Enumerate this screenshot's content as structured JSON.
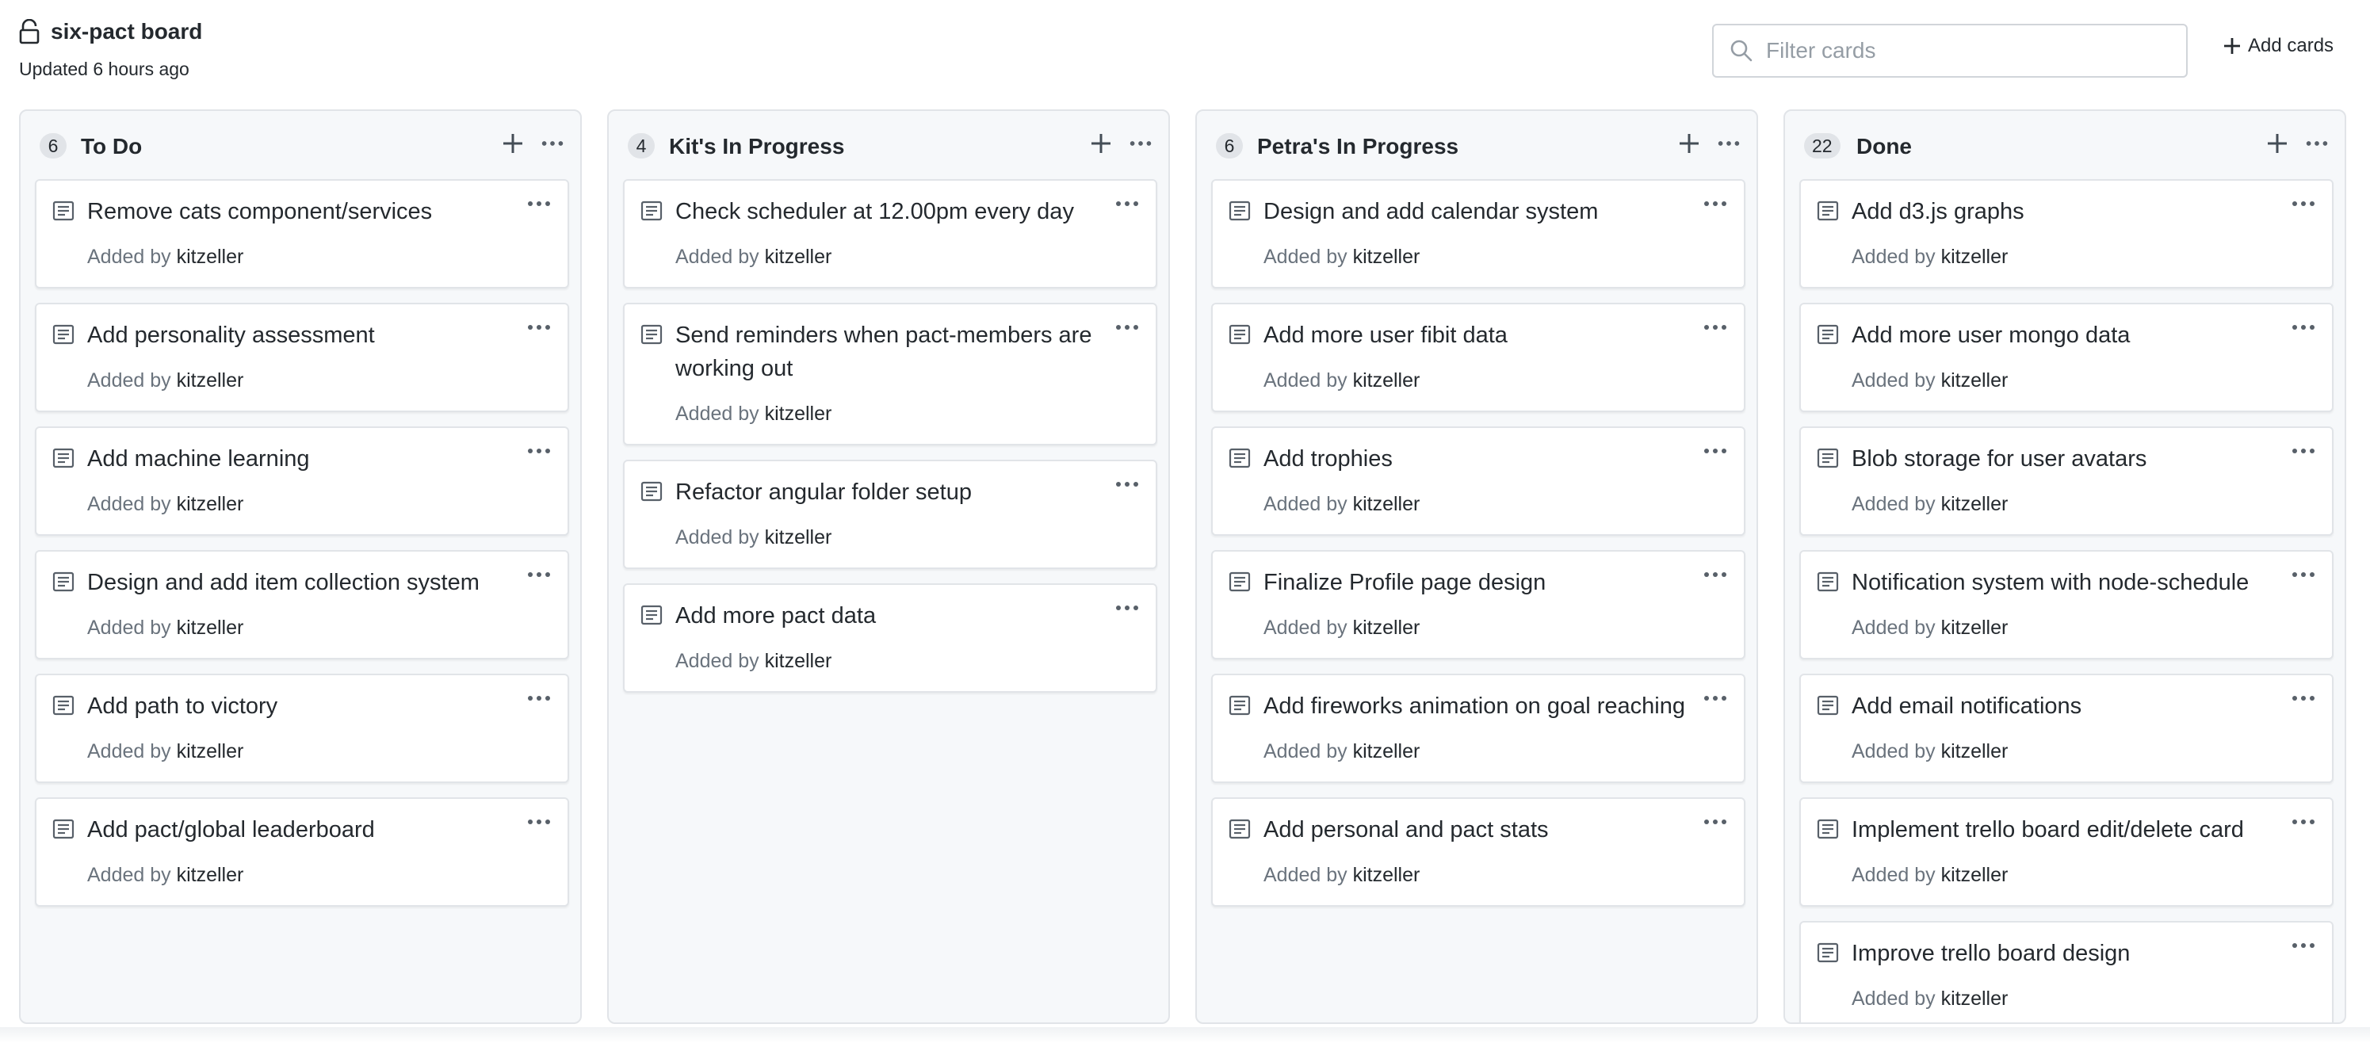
{
  "board": {
    "title": "six-pact board",
    "updated": "Updated 6 hours ago",
    "filter_placeholder": "Filter cards",
    "add_cards_label": "Add cards"
  },
  "columns": [
    {
      "count": "6",
      "title": "To Do",
      "cards": [
        {
          "title": "Remove cats component/services",
          "added_by": "Added by",
          "author": "kitzeller"
        },
        {
          "title": "Add personality assessment",
          "added_by": "Added by",
          "author": "kitzeller"
        },
        {
          "title": "Add machine learning",
          "added_by": "Added by",
          "author": "kitzeller"
        },
        {
          "title": "Design and add item collection system",
          "added_by": "Added by",
          "author": "kitzeller"
        },
        {
          "title": "Add path to victory",
          "added_by": "Added by",
          "author": "kitzeller"
        },
        {
          "title": "Add pact/global leaderboard",
          "added_by": "Added by",
          "author": "kitzeller"
        }
      ]
    },
    {
      "count": "4",
      "title": "Kit's In Progress",
      "cards": [
        {
          "title": "Check scheduler at 12.00pm every day",
          "added_by": "Added by",
          "author": "kitzeller"
        },
        {
          "title": "Send reminders when pact-members are working out",
          "added_by": "Added by",
          "author": "kitzeller"
        },
        {
          "title": "Refactor angular folder setup",
          "added_by": "Added by",
          "author": "kitzeller"
        },
        {
          "title": "Add more pact data",
          "added_by": "Added by",
          "author": "kitzeller"
        }
      ]
    },
    {
      "count": "6",
      "title": "Petra's In Progress",
      "cards": [
        {
          "title": "Design and add calendar system",
          "added_by": "Added by",
          "author": "kitzeller"
        },
        {
          "title": "Add more user fibit data",
          "added_by": "Added by",
          "author": "kitzeller"
        },
        {
          "title": "Add trophies",
          "added_by": "Added by",
          "author": "kitzeller"
        },
        {
          "title": "Finalize Profile page design",
          "added_by": "Added by",
          "author": "kitzeller"
        },
        {
          "title": "Add fireworks animation on goal reaching",
          "added_by": "Added by",
          "author": "kitzeller"
        },
        {
          "title": "Add personal and pact stats",
          "added_by": "Added by",
          "author": "kitzeller"
        }
      ]
    },
    {
      "count": "22",
      "title": "Done",
      "cards": [
        {
          "title": "Add d3.js graphs",
          "added_by": "Added by",
          "author": "kitzeller"
        },
        {
          "title": "Add more user mongo data",
          "added_by": "Added by",
          "author": "kitzeller"
        },
        {
          "title": "Blob storage for user avatars",
          "added_by": "Added by",
          "author": "kitzeller"
        },
        {
          "title": "Notification system with node-schedule",
          "added_by": "Added by",
          "author": "kitzeller"
        },
        {
          "title": "Add email notifications",
          "added_by": "Added by",
          "author": "kitzeller"
        },
        {
          "title": "Implement trello board edit/delete card",
          "added_by": "Added by",
          "author": "kitzeller"
        },
        {
          "title": "Improve trello board design",
          "added_by": "Added by",
          "author": "kitzeller"
        }
      ]
    }
  ],
  "icons": {
    "lock": "lock-icon",
    "search": "search-icon",
    "plus": "plus-icon",
    "more": "more-horizontal-icon",
    "note": "note-icon"
  }
}
